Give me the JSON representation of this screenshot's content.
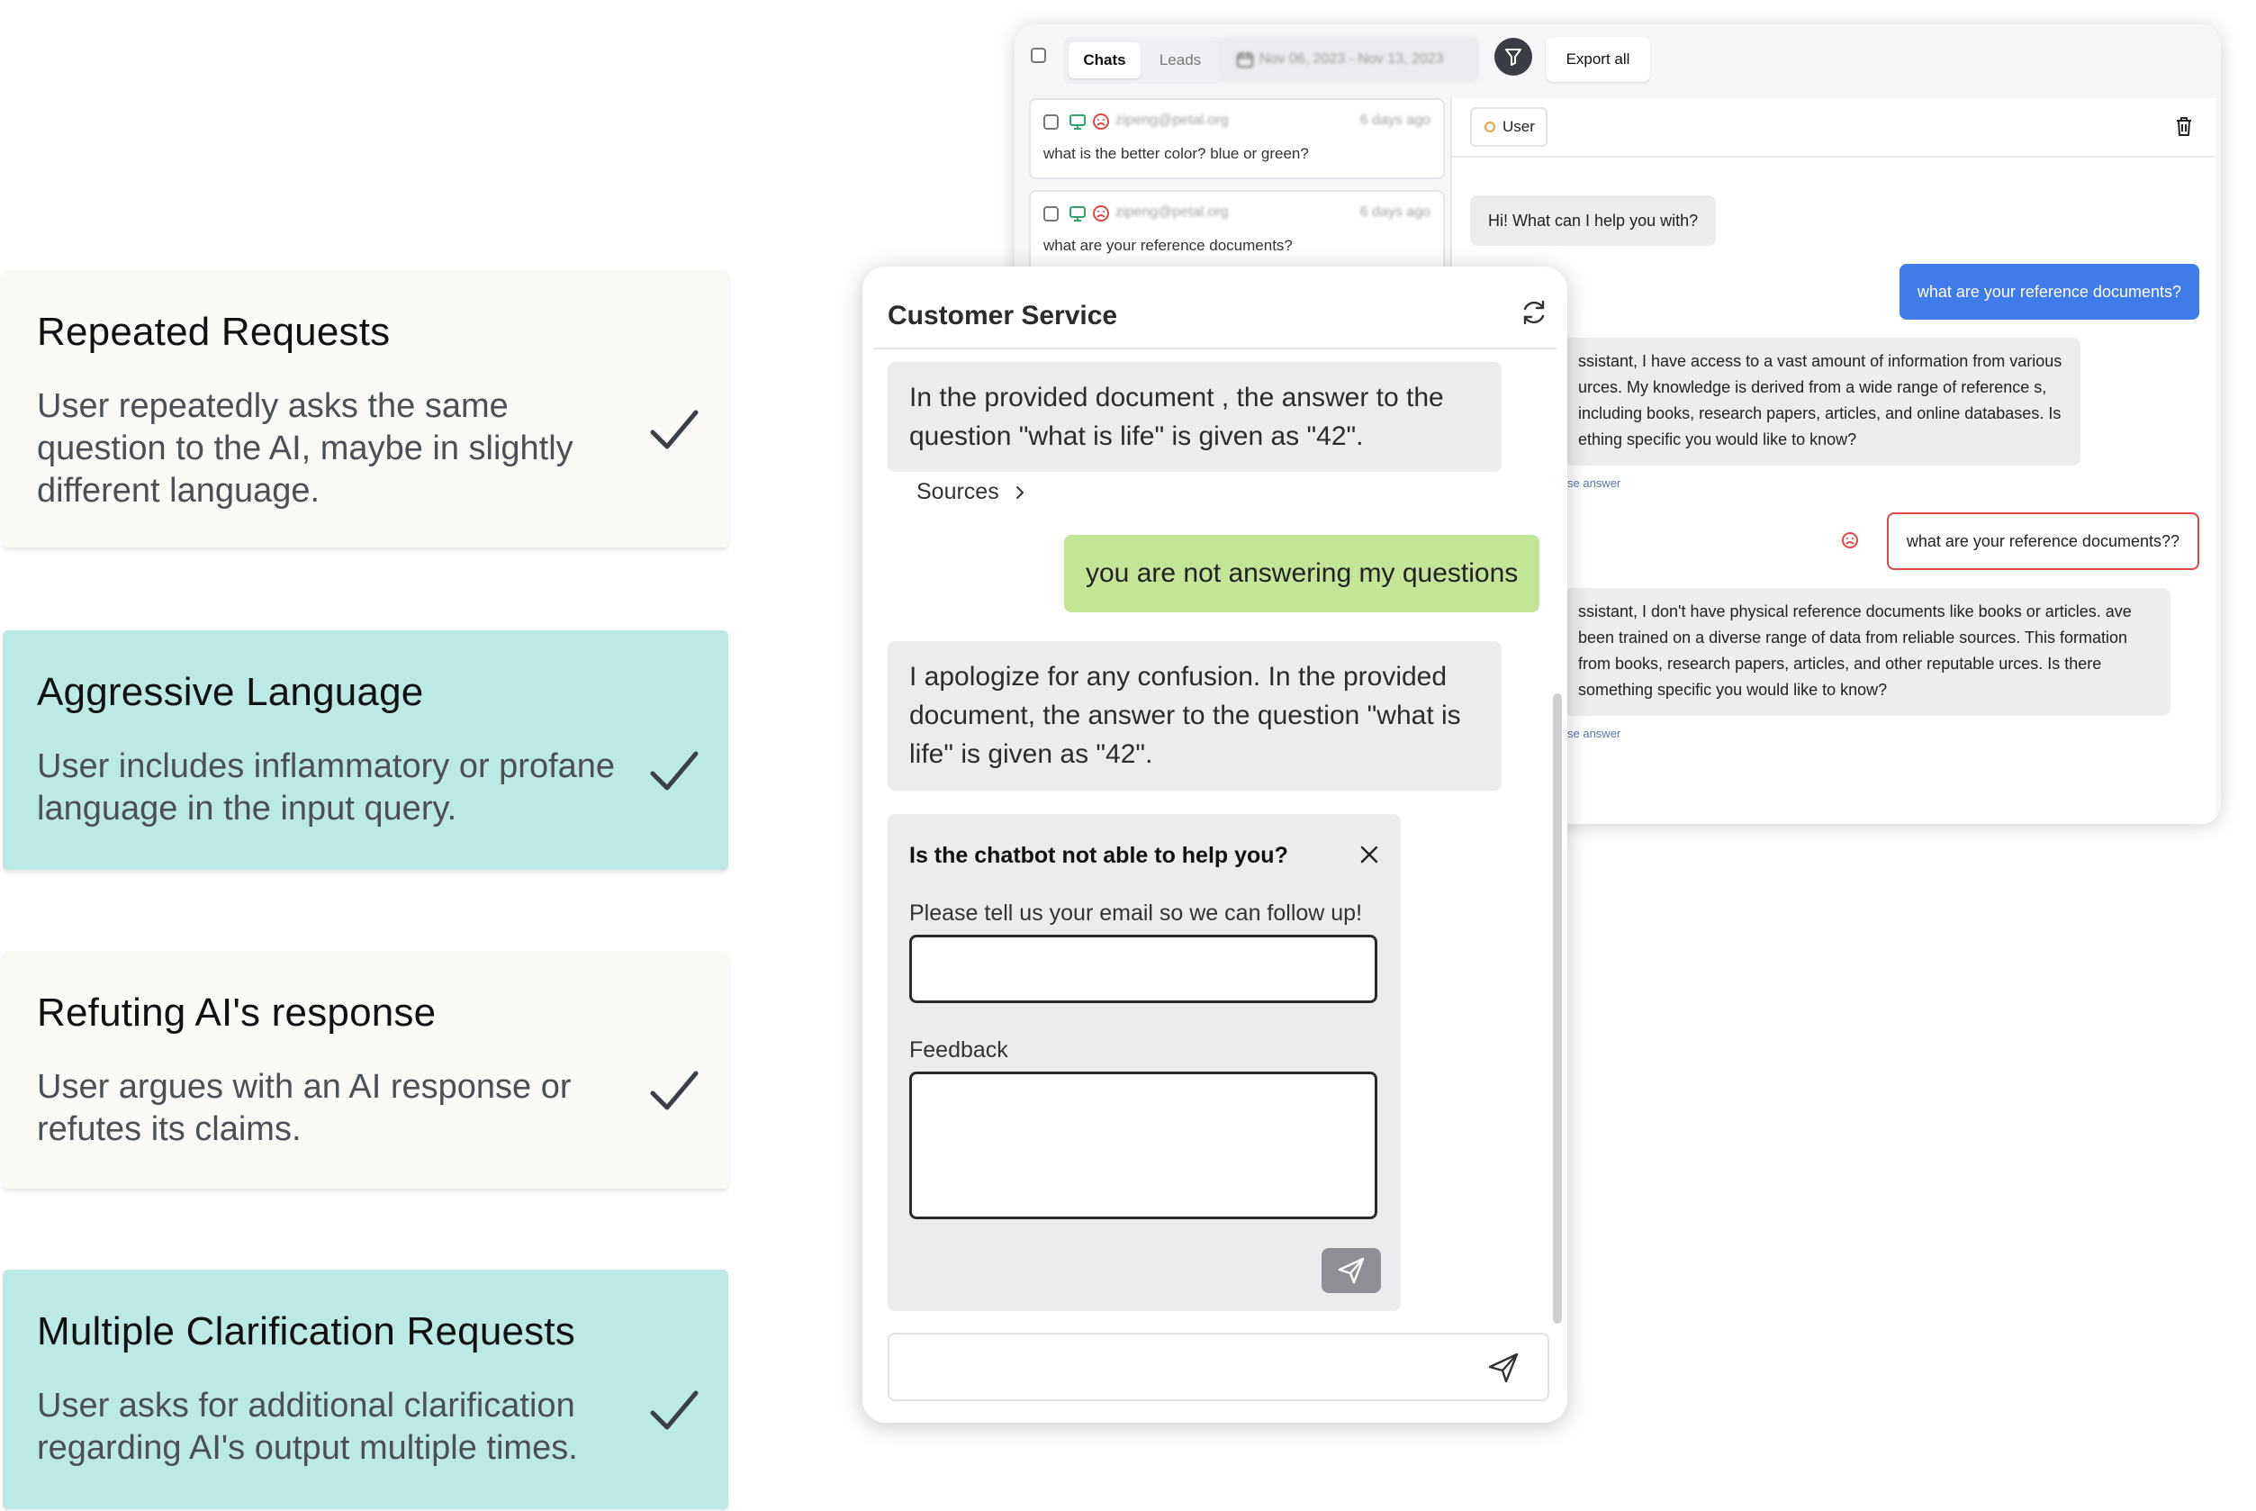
{
  "cards": [
    {
      "title": "Repeated Requests",
      "desc": "User repeatedly asks the same question to the AI, maybe in slightly different language."
    },
    {
      "title": "Aggressive Language",
      "desc": "User includes inflammatory or profane language in the input query."
    },
    {
      "title": "Refuting AI's response",
      "desc": "User argues with an AI response or refutes its claims."
    },
    {
      "title": "Multiple Clarification Requests",
      "desc": "User asks for additional clarification regarding AI's output multiple times."
    }
  ],
  "admin": {
    "tabs": {
      "active": "Chats",
      "inactive": "Leads"
    },
    "date_range": "Nov 06, 2023 - Nov 13, 2023",
    "export_label": "Export all",
    "list": [
      {
        "email": "zipeng@petal.org",
        "ago": "6 days ago",
        "question": "what is the better color? blue or green?"
      },
      {
        "email": "zipeng@petal.org",
        "ago": "6 days ago",
        "question": "what are your reference documents?"
      }
    ],
    "chat": {
      "user_chip": "User",
      "greeting": "Hi! What can I help you with?",
      "user_msg_1": "what are your reference documents?",
      "bot_reply_1": "ssistant, I have access to a vast amount of information from various urces. My knowledge is derived from a wide range of reference s, including books, research papers, articles, and online databases. Is ething specific you would like to know?",
      "footnote_1": "se answer",
      "user_msg_2": "what are your reference documents??",
      "bot_reply_2": "ssistant, I don't have physical reference documents like books or articles. ave been trained on a diverse range of data from reliable sources. This formation from books, research papers, articles, and other reputable urces. Is there something specific you would like to know?",
      "footnote_2": "se answer"
    }
  },
  "cs": {
    "title": "Customer Service",
    "bot_msg_1": "In the provided document , the answer to the question \"what is life\" is given as \"42\".",
    "sources_label": "Sources",
    "user_msg": "you are not answering my questions",
    "bot_msg_2": "I apologize for any confusion. In the provided document, the answer to the question \"what is life\" is given as \"42\".",
    "feedback": {
      "title": "Is the chatbot not able to help you?",
      "email_label": "Please tell us your email so we can follow up!",
      "email_value": "",
      "feedback_label": "Feedback",
      "feedback_value": ""
    },
    "input_value": ""
  },
  "colors": {
    "teal_card": "#bde9e4",
    "cream_card": "#faf9f5",
    "user_green": "#c2e597",
    "admin_blue": "#3f7be9",
    "alert_red": "#e04646"
  },
  "icons": [
    "check-icon",
    "calendar-icon",
    "filter-icon",
    "monitor-icon",
    "frown-icon",
    "trash-icon",
    "refresh-icon",
    "chevron-right-icon",
    "close-icon",
    "send-icon"
  ]
}
